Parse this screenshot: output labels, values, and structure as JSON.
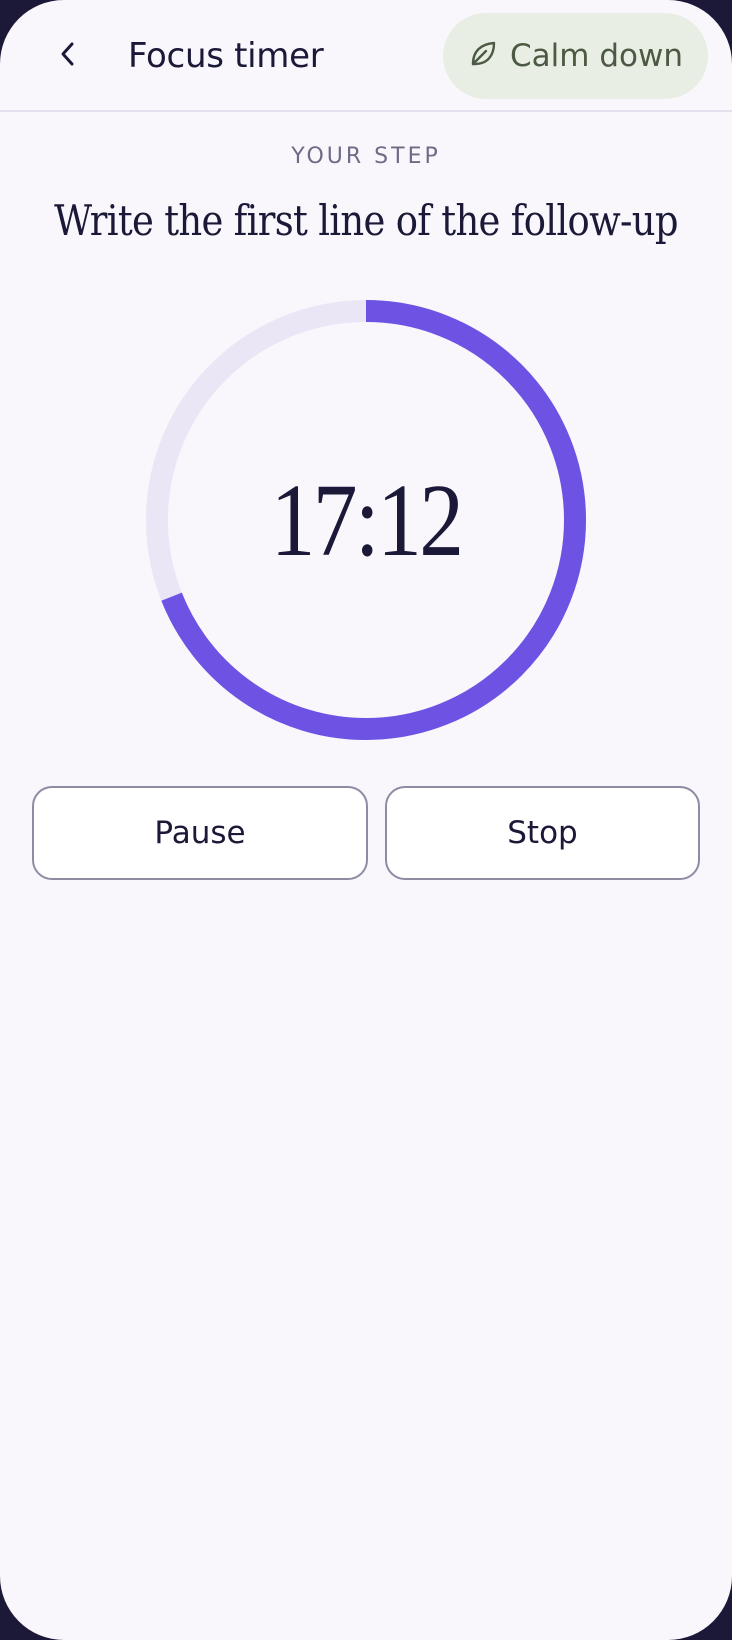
{
  "header": {
    "title": "Focus timer",
    "back_icon": "chevron-left-icon",
    "calm_button": {
      "label": "Calm down",
      "icon": "leaf-icon"
    }
  },
  "step": {
    "eyebrow": "YOUR STEP",
    "title": "Write the first line of the follow-up"
  },
  "timer": {
    "display": "17:12",
    "progress_fraction": 0.69
  },
  "actions": {
    "pause_label": "Pause",
    "stop_label": "Stop"
  },
  "colors": {
    "accent": "#6e52e3",
    "track": "#ebe6f6",
    "calm_bg": "#e9eee4",
    "calm_text": "#4c5a44",
    "background": "#f9f7fc",
    "text": "#1b1838"
  }
}
